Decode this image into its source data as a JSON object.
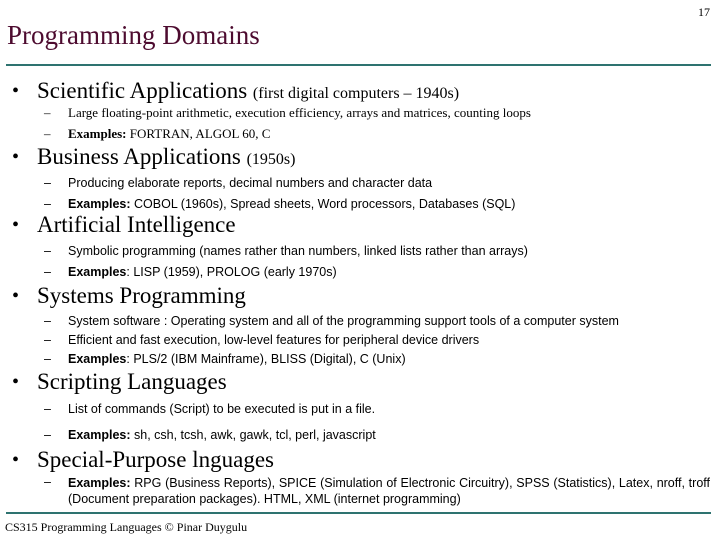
{
  "slide": {
    "page_number": "17",
    "title": "Programming Domains",
    "footer": "CS315 Programming Languages © Pinar Duygulu",
    "colors": {
      "title": "#4d0b2f",
      "rule": "#2e7370",
      "text": "#000000"
    }
  },
  "sections": [
    {
      "heading": "Scientific Applications",
      "paren": "(first digital computers – 1940s)",
      "items": [
        {
          "label": "",
          "text": "Large floating-point arithmetic, execution efficiency, arrays and matrices, counting loops"
        },
        {
          "label": "Examples:",
          "text": " FORTRAN, ALGOL 60, C"
        }
      ]
    },
    {
      "heading": "Business Applications",
      "paren": "(1950s)",
      "items": [
        {
          "label": "",
          "text": "Producing elaborate reports, decimal numbers and character data"
        },
        {
          "label": "Examples:",
          "text": " COBOL (1960s), Spread sheets, Word processors, Databases (SQL)"
        }
      ]
    },
    {
      "heading": "Artificial Intelligence",
      "paren": "",
      "items": [
        {
          "label": "",
          "text": "Symbolic programming (names rather than numbers, linked lists rather than arrays)"
        },
        {
          "label": "Examples",
          "text": ": LISP (1959), PROLOG (early 1970s)"
        }
      ]
    },
    {
      "heading": "Systems Programming",
      "paren": "",
      "items": [
        {
          "label": "",
          "text": "System software : Operating system and all of the programming support tools of a computer system"
        },
        {
          "label": "",
          "text": "Efficient and fast execution, low-level features for peripheral device drivers"
        },
        {
          "label": "Examples",
          "text": ": PLS/2 (IBM Mainframe), BLISS (Digital), C (Unix)"
        }
      ]
    },
    {
      "heading": "Scripting Languages",
      "paren": "",
      "items": [
        {
          "label": "",
          "text": "List of commands (Script) to be executed is put in a file."
        },
        {
          "label": "Examples:",
          "text": " sh, csh, tcsh, awk, gawk, tcl, perl, javascript"
        }
      ]
    },
    {
      "heading": "Special-Purpose lnguages",
      "paren": "",
      "items": [
        {
          "label": "Examples:",
          "text": " RPG (Business Reports), SPICE (Simulation of Electronic Circuitry), SPSS (Statistics), Latex, nroff, troff (Document preparation packages). HTML, XML (internet programming)"
        }
      ]
    }
  ],
  "glyphs": {
    "bullet": "•",
    "dash": "–"
  }
}
